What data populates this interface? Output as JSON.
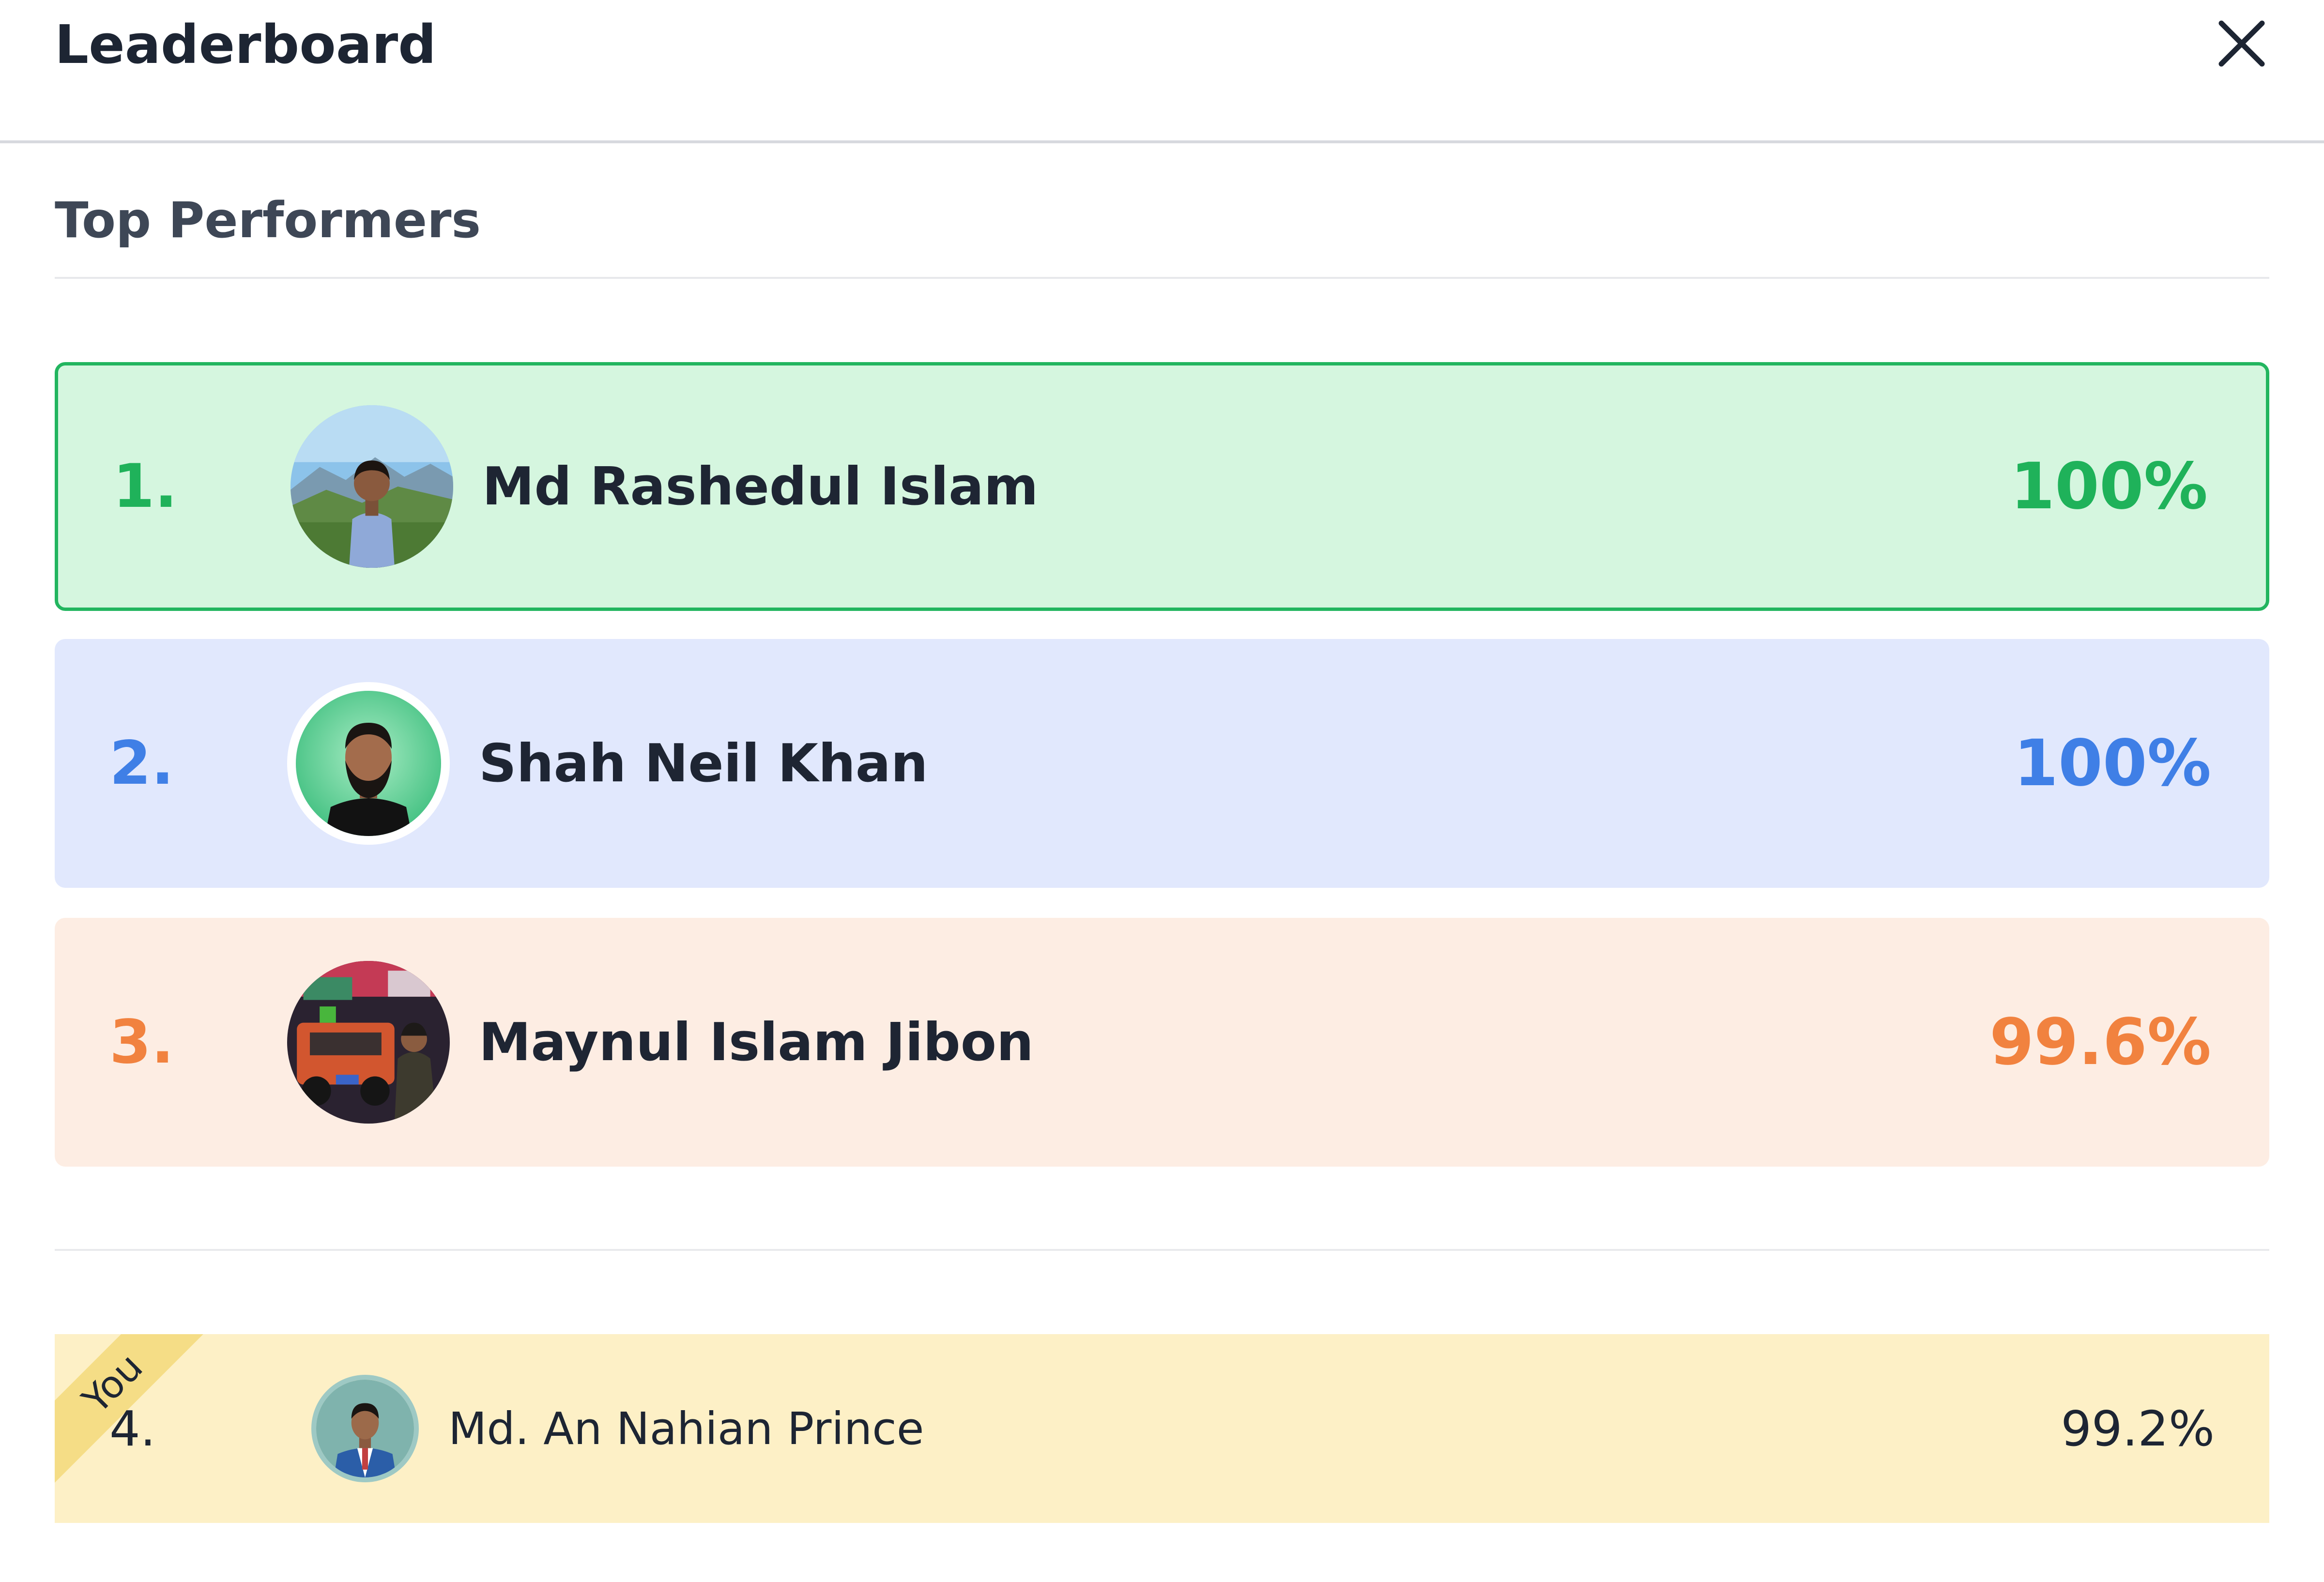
{
  "header": {
    "title": "Leaderboard",
    "close_icon": "close-icon"
  },
  "section": {
    "title": "Top Performers"
  },
  "top_performers": [
    {
      "rank": "1.",
      "name": "Md Rashedul Islam",
      "score": "100%",
      "bg_color": "#d5f6df",
      "accent_color": "#1fb25a",
      "border_color": "#22b55f"
    },
    {
      "rank": "2.",
      "name": "Shah Neil Khan",
      "score": "100%",
      "bg_color": "#e1e8fd",
      "accent_color": "#3f7fe6"
    },
    {
      "rank": "3.",
      "name": "Maynul Islam Jibon",
      "score": "99.6%",
      "bg_color": "#fdede3",
      "accent_color": "#f1823f"
    }
  ],
  "current_user": {
    "badge": "You",
    "rank": "4.",
    "name": "Md. An Nahian Prince",
    "score": "99.2%",
    "bg_color": "#fdf0c6",
    "badge_color": "#f5dd86"
  }
}
